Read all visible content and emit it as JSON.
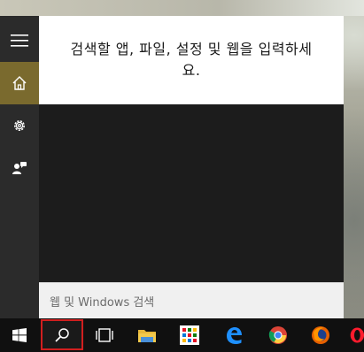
{
  "start_menu": {
    "search_hint": "검색할 앱, 파일, 설정 및 웹을 입력하세요.",
    "search_input_placeholder": "웹 및 Windows 검색",
    "rail": [
      {
        "icon": "hamburger-icon"
      },
      {
        "icon": "home-icon",
        "active": true
      },
      {
        "icon": "gear-icon"
      },
      {
        "icon": "feedback-icon"
      }
    ]
  },
  "taskbar": {
    "items": [
      {
        "icon": "windows-start-icon"
      },
      {
        "icon": "search-icon",
        "highlighted": true
      },
      {
        "icon": "task-view-icon"
      },
      {
        "icon": "file-explorer-icon"
      },
      {
        "icon": "store-icon"
      },
      {
        "icon": "edge-icon"
      },
      {
        "icon": "chrome-icon"
      },
      {
        "icon": "firefox-icon"
      },
      {
        "icon": "opera-icon"
      }
    ]
  },
  "colors": {
    "accent": "#7a6a2e",
    "highlight_border": "#d11f1f",
    "taskbar": "#101010",
    "panel": "#1f1f1f"
  }
}
